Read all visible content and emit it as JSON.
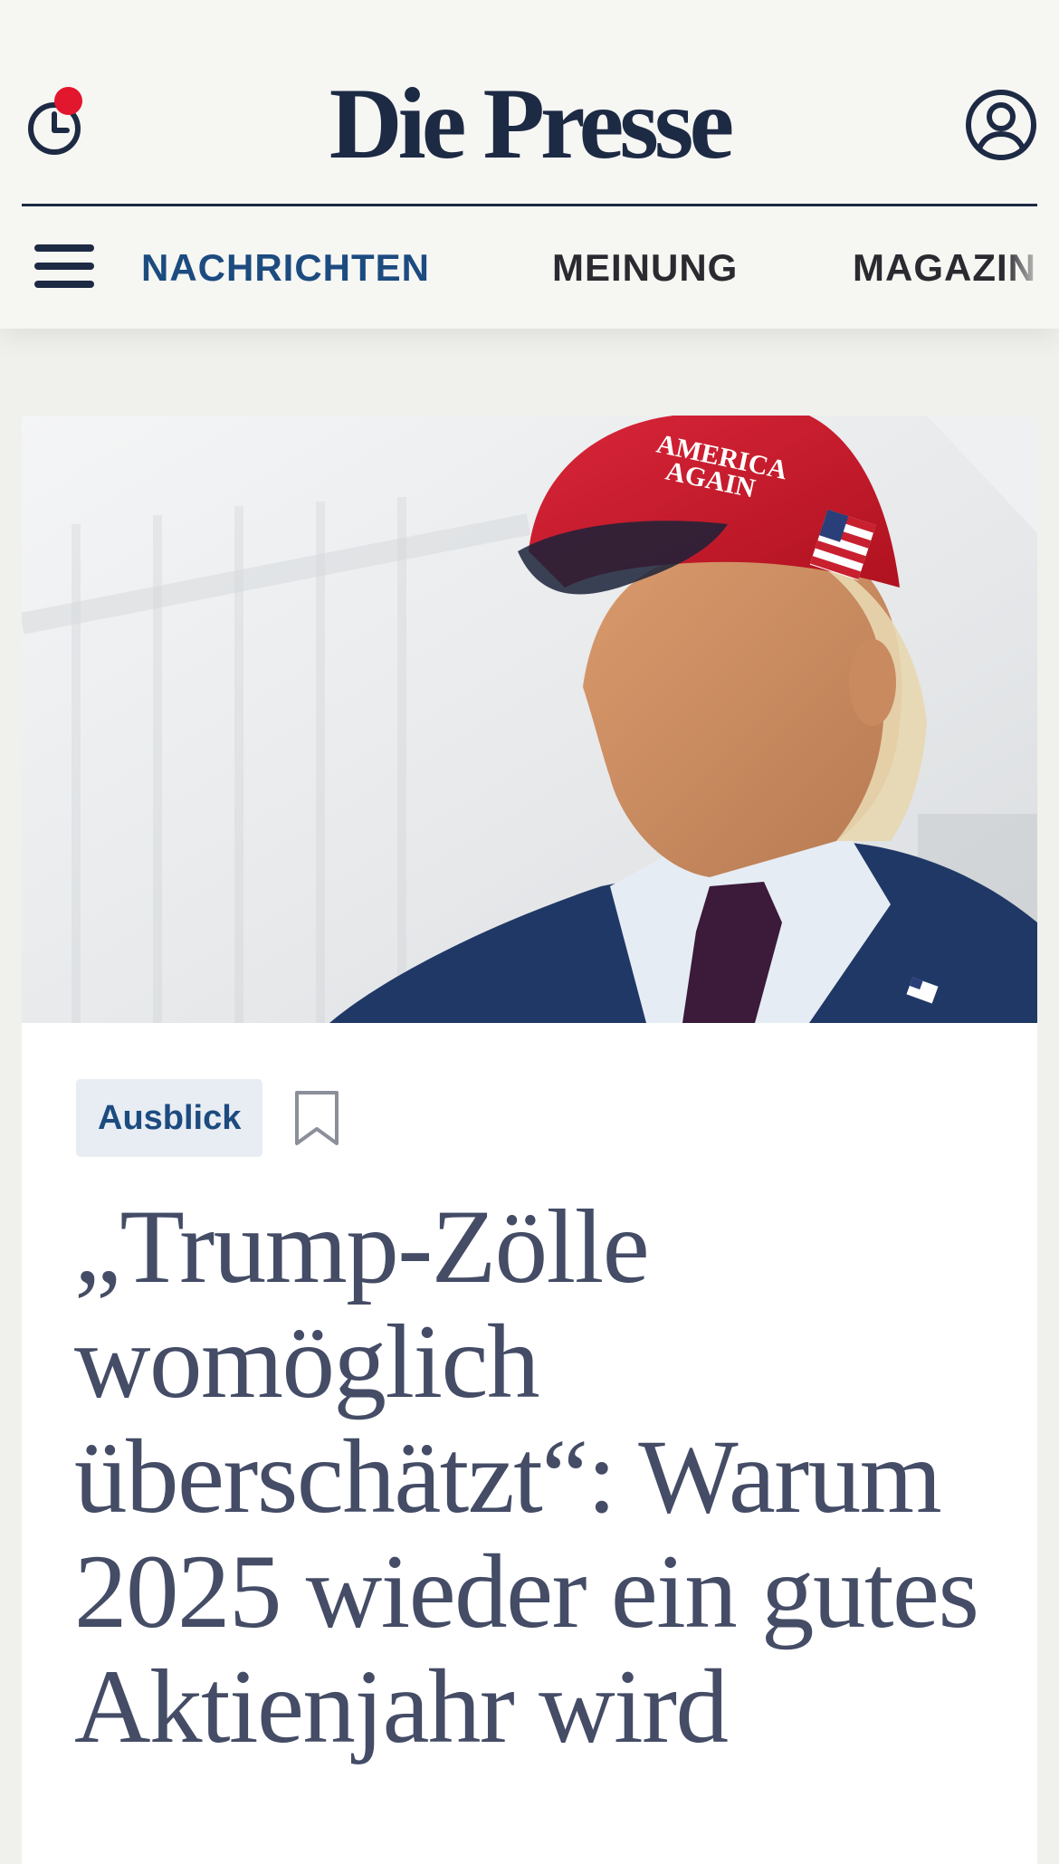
{
  "header": {
    "logo": "Die Presse",
    "history_has_notification": true,
    "notification_color": "#e2162d"
  },
  "nav": {
    "items": [
      {
        "label": "NACHRICHTEN",
        "active": true
      },
      {
        "label": "MEINUNG",
        "active": false
      },
      {
        "label": "MAGAZIN",
        "active": false
      }
    ]
  },
  "article": {
    "image_alt": "Donald Trump mit roter Kappe",
    "cap_text_line1": "AMERICA",
    "cap_text_line2": "AGAIN",
    "tag": "Ausblick",
    "headline": "„Trump-Zölle womöglich überschätzt“: Warum 2025 wieder ein gutes Aktienjahr wird"
  },
  "colors": {
    "brand_navy": "#1d2a44",
    "nav_active": "#1c4b80",
    "headline": "#444c66",
    "tag_background": "#e8edf3"
  }
}
